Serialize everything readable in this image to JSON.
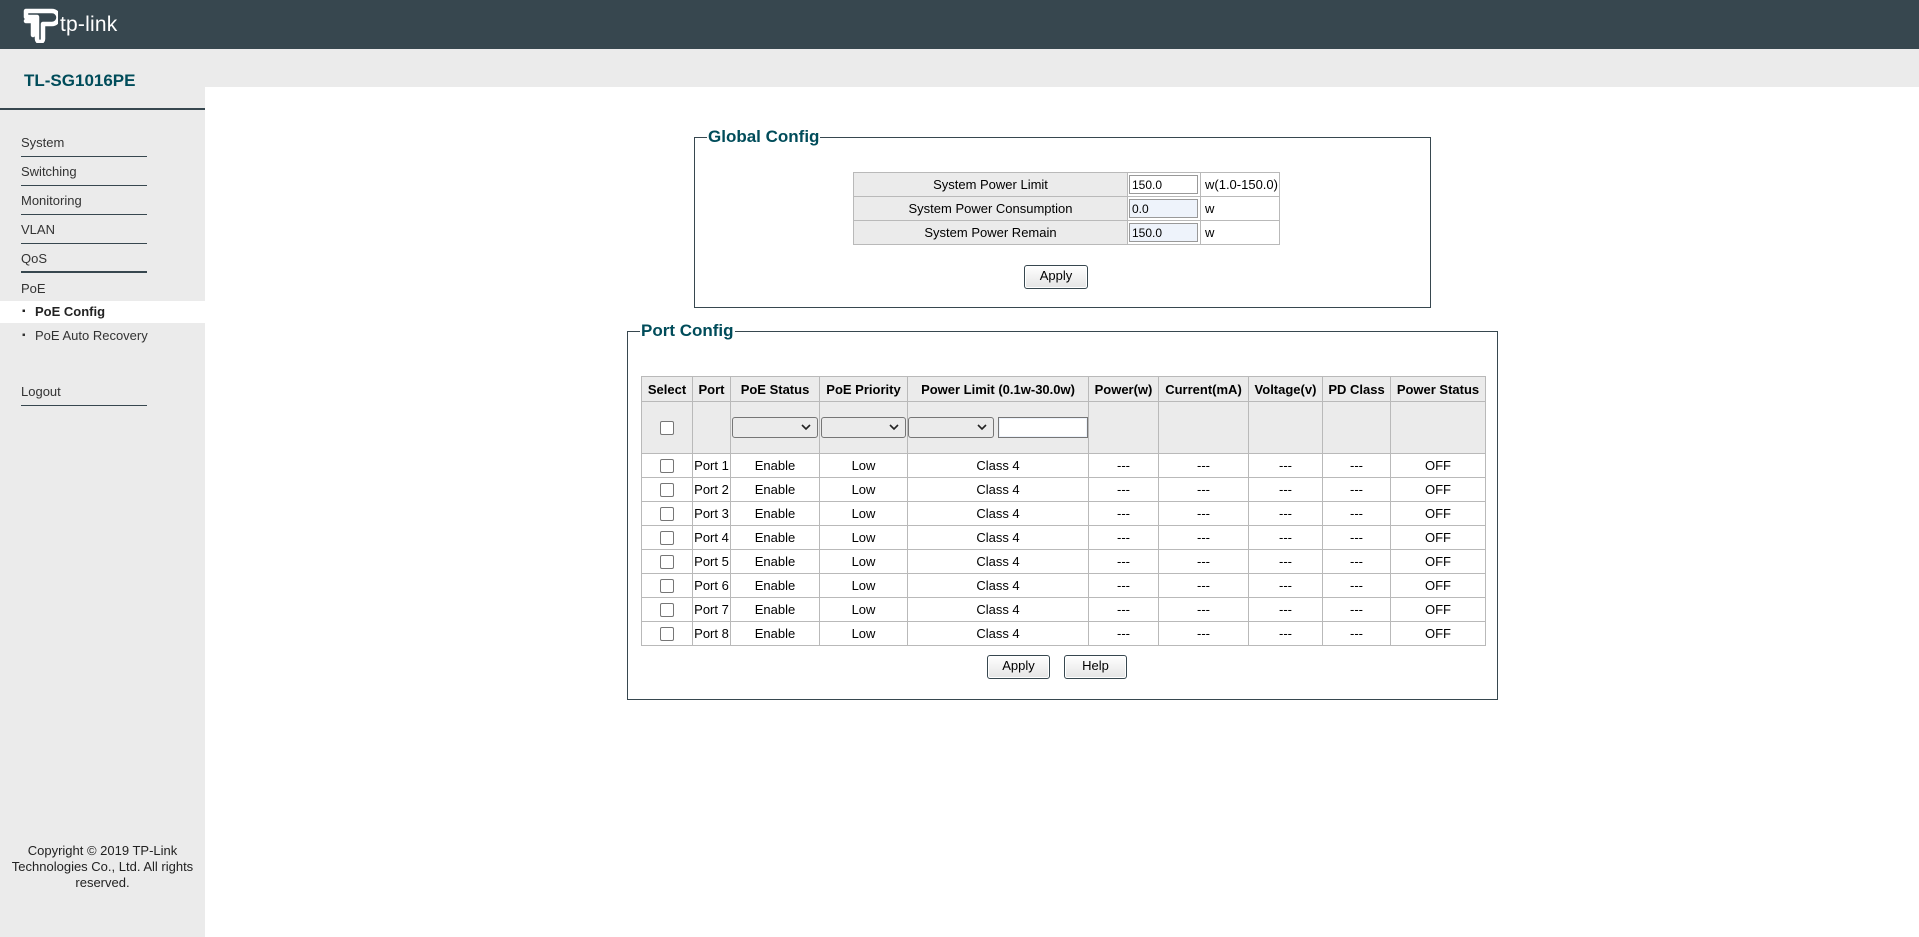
{
  "brand": {
    "logo_text": "tp-link",
    "model": "TL-SG1016PE"
  },
  "sidebar": {
    "items": [
      {
        "label": "System"
      },
      {
        "label": "Switching"
      },
      {
        "label": "Monitoring"
      },
      {
        "label": "VLAN"
      },
      {
        "label": "QoS"
      },
      {
        "label": "PoE"
      },
      {
        "label": "Logout"
      }
    ],
    "poe_sub": [
      {
        "label": "PoE Config",
        "active": true
      },
      {
        "label": "PoE Auto Recovery",
        "active": false
      }
    ],
    "copyright": "Copyright © 2019 TP-Link Technologies Co., Ltd. All rights reserved."
  },
  "global_config": {
    "legend": "Global Config",
    "rows": [
      {
        "label": "System Power Limit",
        "value": "150.0",
        "unit": "w(1.0-150.0)"
      },
      {
        "label": "System Power Consumption",
        "value": "0.0",
        "unit": "w"
      },
      {
        "label": "System Power Remain",
        "value": "150.0",
        "unit": "w"
      }
    ],
    "apply_label": "Apply"
  },
  "port_config": {
    "legend": "Port Config",
    "headers": [
      "Select",
      "Port",
      "PoE Status",
      "PoE Priority",
      "Power Limit (0.1w-30.0w)",
      "Power(w)",
      "Current(mA)",
      "Voltage(v)",
      "PD Class",
      "Power Status"
    ],
    "rows": [
      {
        "port": "Port 1",
        "status": "Enable",
        "priority": "Low",
        "limit": "Class 4",
        "power": "---",
        "current": "---",
        "voltage": "---",
        "pd_class": "---",
        "power_status": "OFF"
      },
      {
        "port": "Port 2",
        "status": "Enable",
        "priority": "Low",
        "limit": "Class 4",
        "power": "---",
        "current": "---",
        "voltage": "---",
        "pd_class": "---",
        "power_status": "OFF"
      },
      {
        "port": "Port 3",
        "status": "Enable",
        "priority": "Low",
        "limit": "Class 4",
        "power": "---",
        "current": "---",
        "voltage": "---",
        "pd_class": "---",
        "power_status": "OFF"
      },
      {
        "port": "Port 4",
        "status": "Enable",
        "priority": "Low",
        "limit": "Class 4",
        "power": "---",
        "current": "---",
        "voltage": "---",
        "pd_class": "---",
        "power_status": "OFF"
      },
      {
        "port": "Port 5",
        "status": "Enable",
        "priority": "Low",
        "limit": "Class 4",
        "power": "---",
        "current": "---",
        "voltage": "---",
        "pd_class": "---",
        "power_status": "OFF"
      },
      {
        "port": "Port 6",
        "status": "Enable",
        "priority": "Low",
        "limit": "Class 4",
        "power": "---",
        "current": "---",
        "voltage": "---",
        "pd_class": "---",
        "power_status": "OFF"
      },
      {
        "port": "Port 7",
        "status": "Enable",
        "priority": "Low",
        "limit": "Class 4",
        "power": "---",
        "current": "---",
        "voltage": "---",
        "pd_class": "---",
        "power_status": "OFF"
      },
      {
        "port": "Port 8",
        "status": "Enable",
        "priority": "Low",
        "limit": "Class 4",
        "power": "---",
        "current": "---",
        "voltage": "---",
        "pd_class": "---",
        "power_status": "OFF"
      }
    ],
    "apply_label": "Apply",
    "help_label": "Help"
  }
}
